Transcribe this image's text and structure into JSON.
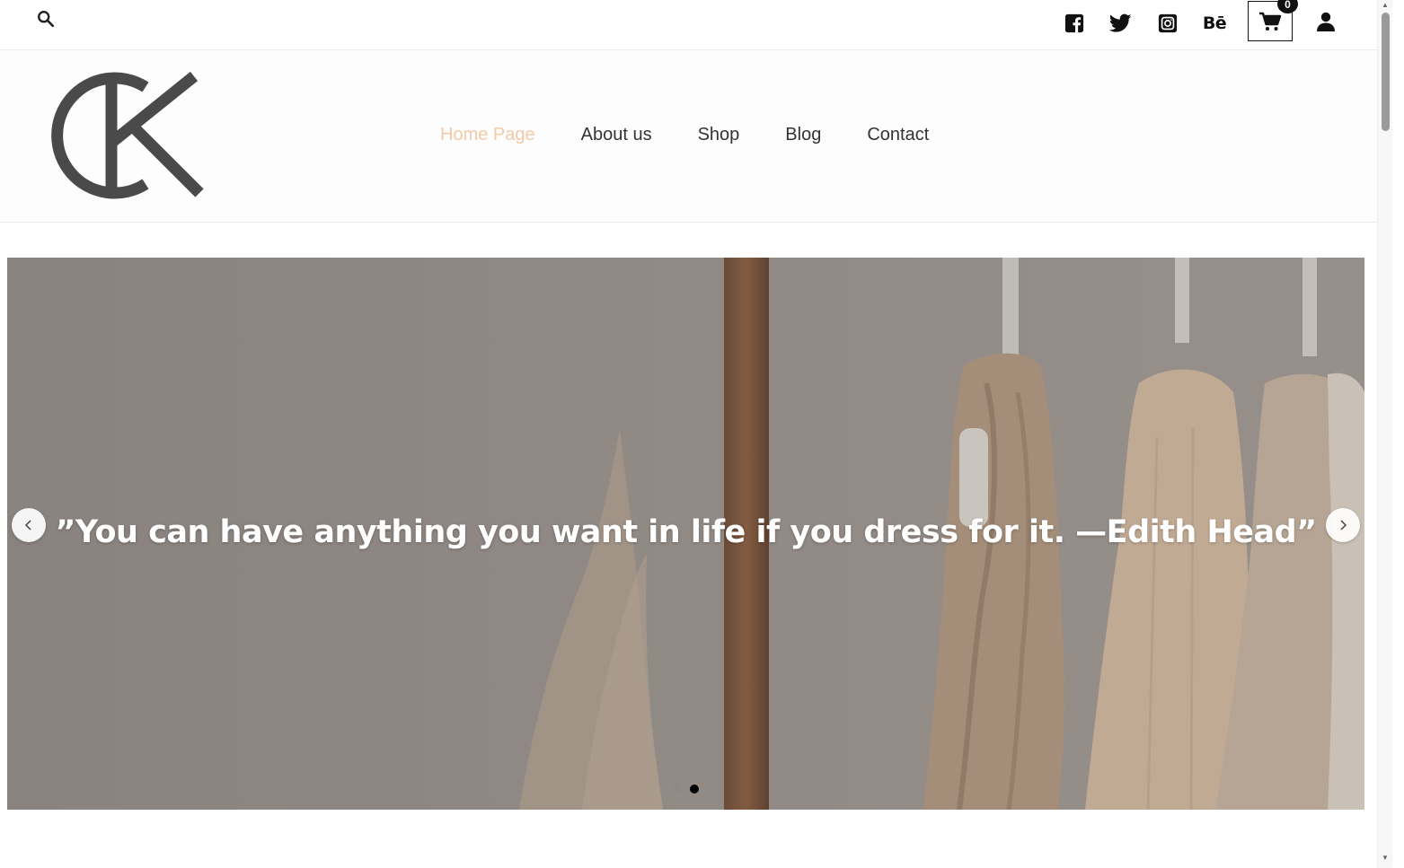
{
  "topbar": {
    "search_icon": "search-icon",
    "social_icons": [
      "facebook-icon",
      "twitter-icon",
      "instagram-icon",
      "behance-icon"
    ],
    "behance_label": "Bē",
    "cart": {
      "icon": "cart-icon",
      "count": "0"
    },
    "account_icon": "user-icon"
  },
  "header": {
    "logo_text": "CK",
    "nav": [
      {
        "label": "Home Page",
        "active": true
      },
      {
        "label": "About us",
        "active": false
      },
      {
        "label": "Shop",
        "active": false
      },
      {
        "label": "Blog",
        "active": false
      },
      {
        "label": "Contact",
        "active": false
      }
    ],
    "active_color": "#f3c9a6"
  },
  "hero": {
    "quote": "”You can have anything you want in life if you dress for it. —Edith Head”",
    "prev_icon": "chevron-left-icon",
    "next_icon": "chevron-right-icon",
    "slides_total": 2,
    "active_slide": 2
  }
}
